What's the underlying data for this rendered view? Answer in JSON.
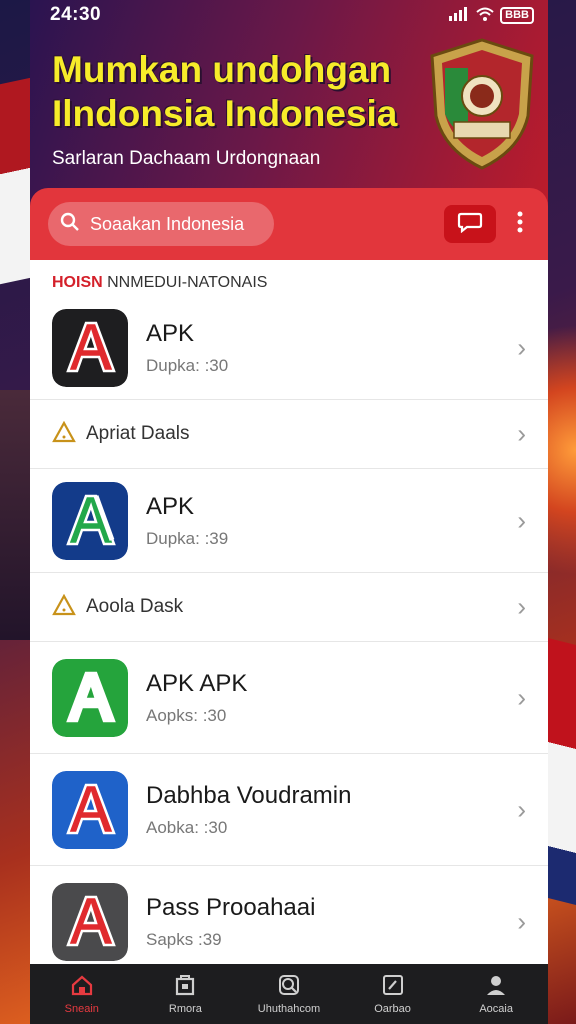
{
  "status_bar": {
    "time": "24:30",
    "battery": "BBB"
  },
  "hero": {
    "title_line1": "Mumkan undohgan",
    "title_line2": "Ilndonsia Indonesia",
    "subtitle": "Sarlaran Dachaam Urdongnaan"
  },
  "search": {
    "placeholder": "Soaakan Indonesia"
  },
  "section": {
    "prefix": "HOISN",
    "title": "NNMEDUI-NATONAIS"
  },
  "list": [
    {
      "kind": "app",
      "name": "APK",
      "meta": "Dupka: :30",
      "icon": "red-a-dark-icon",
      "icon_bg": "#1e1e20",
      "icon_fg": "#e02a2e"
    },
    {
      "kind": "sub",
      "label": "Apriat Daals",
      "icon": "warning-triangle-icon"
    },
    {
      "kind": "app",
      "name": "APK",
      "meta": "Dupka: :39",
      "icon": "green-a-blue-icon",
      "icon_bg": "#133b8a",
      "icon_fg": "#22a84a"
    },
    {
      "kind": "sub",
      "label": "Aoola Dask",
      "icon": "warning-triangle-icon"
    },
    {
      "kind": "app",
      "name": "APK  APK",
      "meta": "Aopks: :30",
      "icon": "green-a-icon",
      "icon_bg": "#25a43c",
      "icon_fg": "#ffffff"
    },
    {
      "kind": "app",
      "name": "Dabhba Voudramin",
      "meta": "Aobka: :30",
      "icon": "blue-a-icon",
      "icon_bg": "#1f62c9",
      "icon_fg": "#e02a2e"
    },
    {
      "kind": "app",
      "name": "Pass Prooahaai",
      "meta": "Sapks :39",
      "icon": "red-a-gray-icon",
      "icon_bg": "#4a4a4c",
      "icon_fg": "#e02a2e"
    }
  ],
  "bottom_nav": [
    {
      "label": "Sneain",
      "icon": "home-icon",
      "active": true
    },
    {
      "label": "Rmora",
      "icon": "store-icon",
      "active": false
    },
    {
      "label": "Uhuthahcom",
      "icon": "search-icon",
      "active": false
    },
    {
      "label": "Oarbao",
      "icon": "edit-icon",
      "active": false
    },
    {
      "label": "Aocaia",
      "icon": "profile-icon",
      "active": false
    }
  ],
  "colors": {
    "accent": "#e2363c",
    "title_yellow": "#f7ec2a",
    "nav_bg": "#1d1d1f"
  }
}
